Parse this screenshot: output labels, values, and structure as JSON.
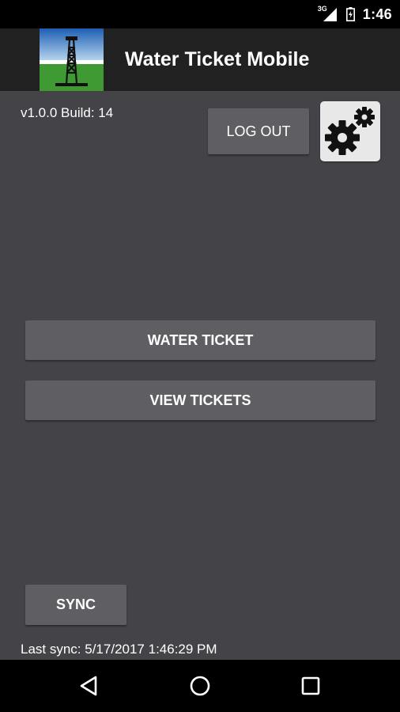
{
  "status_bar": {
    "network_label": "3G",
    "time": "1:46"
  },
  "app_bar": {
    "title": "Water Ticket Mobile",
    "logo_icon": "oil-derrick-icon"
  },
  "header": {
    "version": "v1.0.0 Build: 14",
    "logout_label": "LOG OUT",
    "settings_icon": "gears-icon"
  },
  "main": {
    "water_ticket_label": "WATER TICKET",
    "view_tickets_label": "VIEW TICKETS"
  },
  "footer": {
    "sync_label": "SYNC",
    "last_sync": "Last sync: 5/17/2017 1:46:29 PM"
  },
  "nav_bar": {
    "back_icon": "back-triangle-icon",
    "home_icon": "home-circle-icon",
    "recent_icon": "recent-apps-square-icon"
  },
  "colors": {
    "background": "#444448",
    "app_bar": "#212121",
    "button": "#5f5f63",
    "settings_button": "#e8e8e8",
    "text": "#ffffff"
  }
}
